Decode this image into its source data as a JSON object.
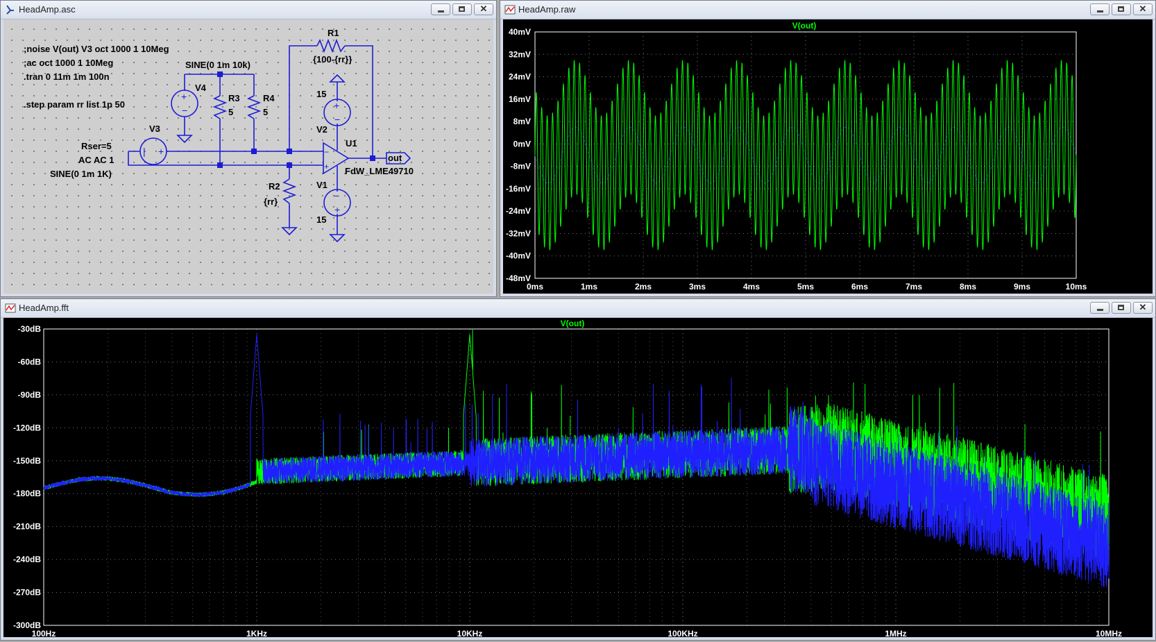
{
  "schematic": {
    "title": "HeadAmp.asc",
    "directives": [
      ";noise V(out) V3 oct 1000 1 10Meg",
      ";ac oct 1000 1 10Meg",
      ".tran 0 11m 1m 100n",
      ".step param rr list 1p 50"
    ],
    "v4": {
      "name": "V4",
      "value": "SINE(0 1m 10k)"
    },
    "r3": {
      "name": "R3",
      "value": "5"
    },
    "r4": {
      "name": "R4",
      "value": "5"
    },
    "r1": {
      "name": "R1",
      "value": "{100-{rr}}"
    },
    "r2": {
      "name": "R2",
      "value": "{rr}"
    },
    "v3": {
      "name": "V3",
      "line1": "Rser=5",
      "line2": "AC AC 1",
      "line3": "SINE(0 1m 1K)"
    },
    "v2": {
      "name": "V2",
      "value": "15"
    },
    "v1": {
      "name": "V1",
      "value": "15"
    },
    "u1": {
      "name": "U1",
      "model": "FdW_LME49710"
    },
    "out_label": "out"
  },
  "time_plot": {
    "title": "HeadAmp.raw",
    "trace": "V(out)",
    "y_ticks": [
      "40mV",
      "32mV",
      "24mV",
      "16mV",
      "8mV",
      "0mV",
      "-8mV",
      "-16mV",
      "-24mV",
      "-32mV",
      "-40mV",
      "-48mV"
    ],
    "x_ticks": [
      "0ms",
      "1ms",
      "2ms",
      "3ms",
      "4ms",
      "5ms",
      "6ms",
      "7ms",
      "8ms",
      "9ms",
      "10ms"
    ]
  },
  "fft_plot": {
    "title": "HeadAmp.fft",
    "trace": "V(out)",
    "y_ticks": [
      "-30dB",
      "-60dB",
      "-90dB",
      "-120dB",
      "-150dB",
      "-180dB",
      "-210dB",
      "-240dB",
      "-270dB",
      "-300dB"
    ],
    "x_ticks": [
      "100Hz",
      "1KHz",
      "10KHz",
      "100KHz",
      "1MHz",
      "10MHz"
    ]
  },
  "chart_data": [
    {
      "type": "line",
      "title": "V(out)",
      "xlabel": "",
      "ylabel": "",
      "xlim": [
        0,
        10
      ],
      "ylim": [
        -48,
        40
      ],
      "grid": true,
      "series": [
        {
          "name": "",
          "color": "#00ff00",
          "description_params": {
            "f1_khz": 1,
            "a1_mv": 10,
            "f2_khz": 10,
            "a2_mv": 24
          }
        },
        {
          "name": "",
          "color": "#0000ff",
          "description_params": {
            "f1_khz": 1,
            "a1_mv": 10
          }
        }
      ]
    },
    {
      "type": "line",
      "title": "V(out)",
      "xlabel": "",
      "ylabel": "",
      "xscale": "log",
      "xlim": [
        100,
        10000000
      ],
      "ylim": [
        -300,
        -30
      ],
      "grid": true,
      "series": [
        {
          "name": "",
          "color": "#00ff00",
          "peaks": [
            {
              "x": 10000,
              "y": -35
            }
          ]
        },
        {
          "name": "",
          "color": "#0000ff",
          "peaks": [
            {
              "x": 1000,
              "y": -35
            }
          ]
        }
      ]
    }
  ]
}
